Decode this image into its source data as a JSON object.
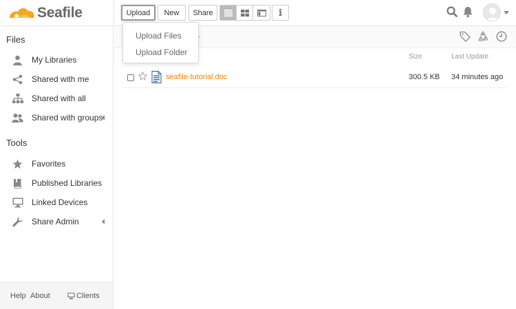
{
  "app": {
    "name": "Seafile"
  },
  "toolbar": {
    "upload_label": "Upload",
    "new_label": "New",
    "share_label": "Share",
    "info_label": "i",
    "views": [
      "list-view",
      "grid-view",
      "column-view"
    ]
  },
  "upload_menu": {
    "items": [
      {
        "label": "Upload Files"
      },
      {
        "label": "Upload Folder"
      }
    ]
  },
  "sidebar": {
    "files_title": "Files",
    "files_items": [
      {
        "label": "My Libraries",
        "icon": "user-icon"
      },
      {
        "label": "Shared with me",
        "icon": "share-icon"
      },
      {
        "label": "Shared with all",
        "icon": "org-tree-icon"
      },
      {
        "label": "Shared with groups",
        "icon": "group-icon"
      }
    ],
    "tools_title": "Tools",
    "tools_items": [
      {
        "label": "Favorites",
        "icon": "star-icon"
      },
      {
        "label": "Published Libraries",
        "icon": "book-icon"
      },
      {
        "label": "Linked Devices",
        "icon": "monitor-icon"
      },
      {
        "label": "Share Admin",
        "icon": "wrench-icon"
      }
    ],
    "footer": {
      "help": "Help",
      "about": "About",
      "clients": "Clients"
    }
  },
  "main": {
    "path_visible": "y",
    "columns": {
      "size": "Size",
      "last_update": "Last Update"
    },
    "files": [
      {
        "name": "seafile-tutorial.doc",
        "size": "300.5 KB",
        "last_update": "34 minutes ago"
      }
    ]
  },
  "colors": {
    "accent": "#eb8205",
    "logo": "#f5a623",
    "text": "#333333"
  }
}
